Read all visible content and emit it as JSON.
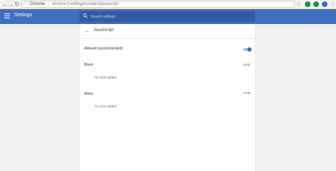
{
  "browser": {
    "back_icon": "back-arrow-icon",
    "forward_icon": "forward-arrow-icon",
    "reload_icon": "reload-icon",
    "chip_label": "Chrome",
    "url": "chrome://settings/content/javascript",
    "extension_colors": [
      "#1a8f4f",
      "#1a8f4f",
      "#3f6fc0"
    ]
  },
  "header": {
    "title": "Settings",
    "search_placeholder": "Search settings",
    "background_color": "#3f6fc0"
  },
  "page": {
    "title": "JavaScript",
    "allowed_label": "Allowed (recommended)",
    "allowed_enabled": true,
    "sections": [
      {
        "label": "Block",
        "add_label": "ADD",
        "empty_text": "No sites added"
      },
      {
        "label": "Allow",
        "add_label": "ADD",
        "empty_text": "No sites added"
      }
    ]
  }
}
